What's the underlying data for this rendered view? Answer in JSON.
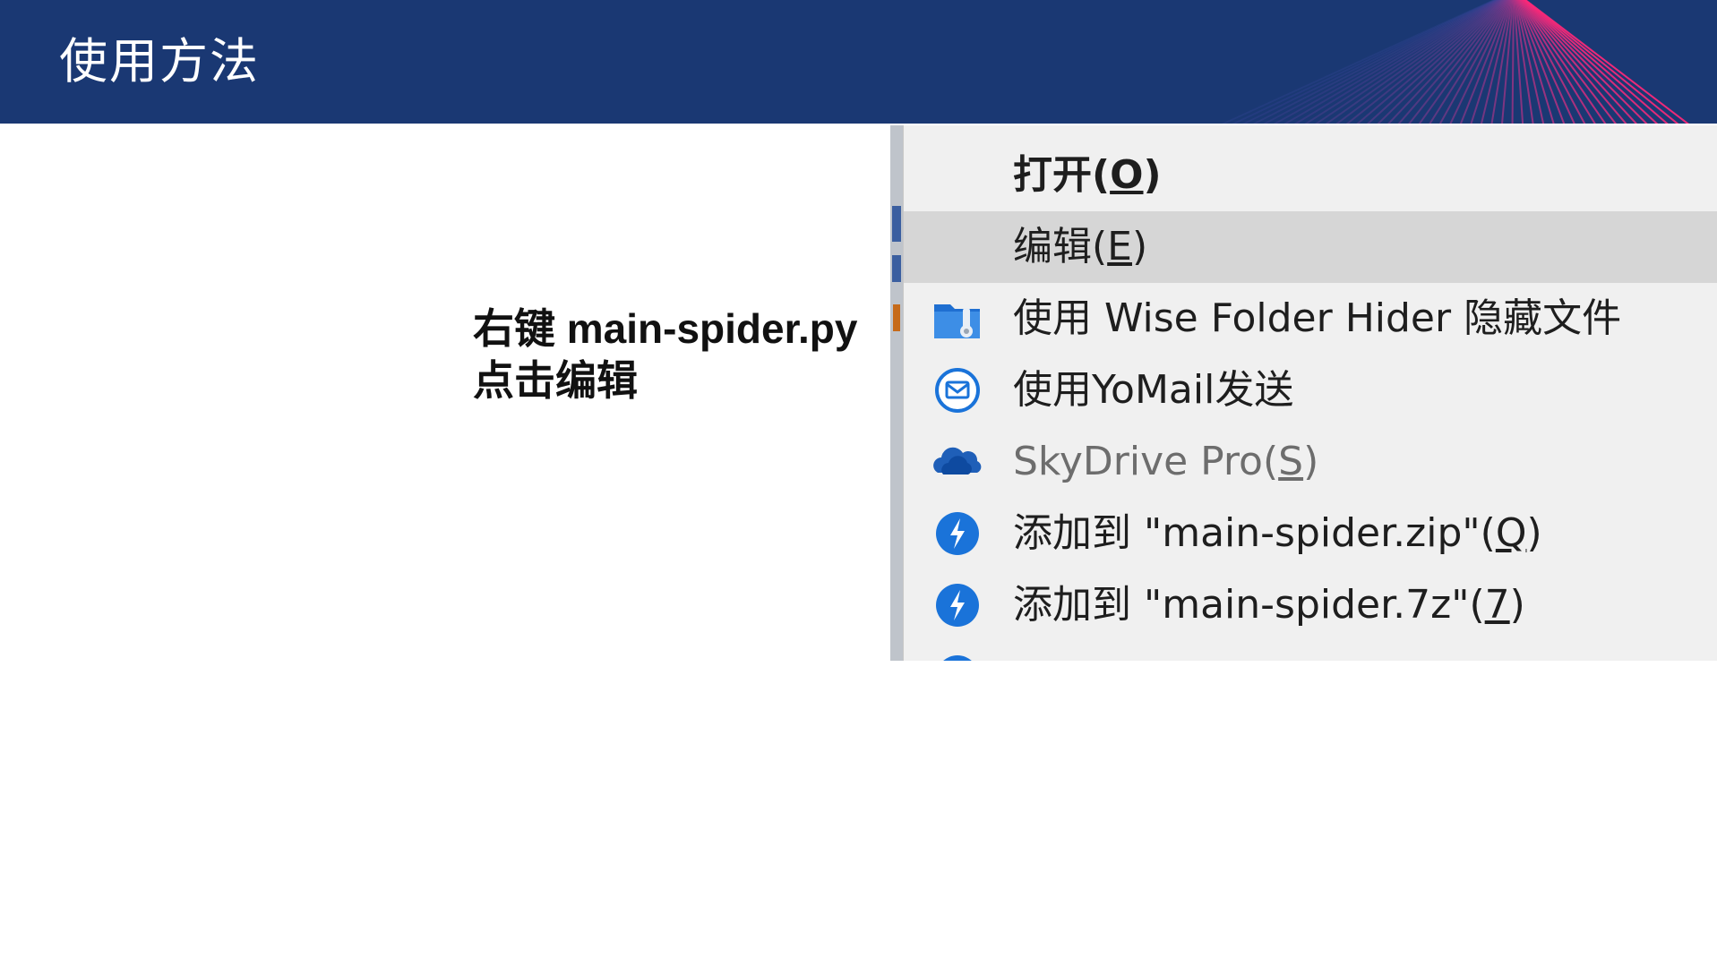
{
  "header": {
    "title": "使用方法"
  },
  "caption": {
    "line1": "右键 main-spider.py",
    "line2": "点击编辑"
  },
  "context_menu": {
    "items": [
      {
        "label": "打开(",
        "accel": "O",
        "tail": ")",
        "icon": "none"
      },
      {
        "label": "编辑(",
        "accel": "E",
        "tail": ")",
        "icon": "none"
      },
      {
        "label": "使用 Wise Folder Hider 隐藏文件",
        "accel": "",
        "tail": "",
        "icon": "folder-lock-icon"
      },
      {
        "label": "使用YoMail发送",
        "accel": "",
        "tail": "",
        "icon": "mail-icon"
      },
      {
        "label": "SkyDrive Pro(",
        "accel": "S",
        "tail": ")",
        "icon": "cloud-icon"
      },
      {
        "label": "添加到 \"main-spider.zip\"(",
        "accel": "Q",
        "tail": ")",
        "icon": "bandizip-icon"
      },
      {
        "label": "添加到 \"main-spider.7z\"(",
        "accel": "7",
        "tail": ")",
        "icon": "bandizip-icon"
      }
    ],
    "highlighted_index": 1
  },
  "colors": {
    "header_bg": "#1a3873",
    "menu_bg": "#f0f0f0",
    "highlight_bg": "#d6d6d6",
    "icon_blue": "#1a73d9"
  }
}
